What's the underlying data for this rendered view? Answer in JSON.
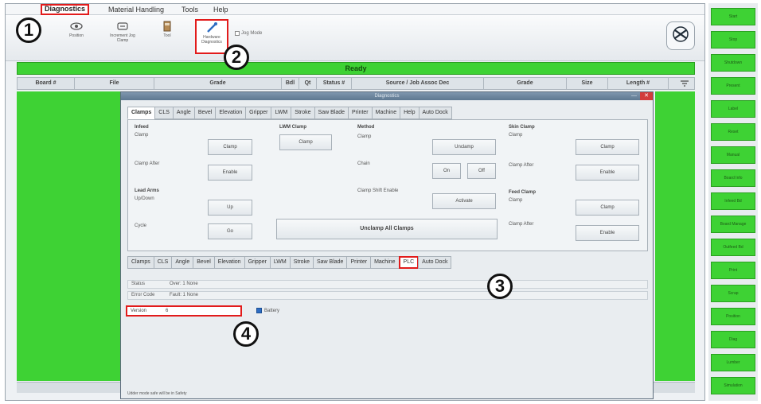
{
  "menubar": {
    "items": [
      "Diagnostics",
      "Material Handling",
      "Tools",
      "Help"
    ]
  },
  "toolbar": {
    "buttons": [
      "Position",
      "Increment Jog Clamp",
      "Tool",
      "Hardware Diagnostics"
    ],
    "checkbox_label": "Jog Mode"
  },
  "status": {
    "text": "Ready"
  },
  "columns": [
    "Board #",
    "File",
    "Grade",
    "Bdl",
    "Qt",
    "Status #",
    "Source / Job Assoc Dec",
    "Grade",
    "Size",
    "Length #"
  ],
  "sidebar": {
    "buttons": [
      "Start",
      "Stop",
      "Shutdown",
      "Present",
      "Label",
      "Reset",
      "Manual",
      "Board Info",
      "Infeed Bd",
      "Board Manage",
      "Outfeed Bd",
      "Print",
      "Scrap",
      "Position",
      "Diag",
      "Lumber",
      "Simulation"
    ]
  },
  "dialog": {
    "title": "Diagnostics",
    "minimize": "—",
    "close": "✕",
    "top_tabs": [
      "Clamps",
      "CLS",
      "Angle",
      "Bevel",
      "Elevation",
      "Gripper",
      "LWM",
      "Stroke",
      "Saw Blade",
      "Printer",
      "Machine",
      "Help",
      "Auto Dock"
    ],
    "bottom_tabs": [
      "Clamps",
      "CLS",
      "Angle",
      "Bevel",
      "Elevation",
      "Gripper",
      "LWM",
      "Stroke",
      "Saw Blade",
      "Printer",
      "Machine",
      "PLC",
      "Auto Dock"
    ],
    "clamps": {
      "infeed": {
        "title": "Infeed",
        "clamp_label": "Clamp",
        "clamp_button": "Clamp",
        "clamp_after_label": "Clamp After",
        "clamp_after_button": "Enable"
      },
      "lwm": {
        "title": "LWM Clamp",
        "button": "Clamp"
      },
      "lead_arms": {
        "title": "Lead Arms",
        "up_down_label": "Up/Down",
        "up_button": "Up",
        "cycle_label": "Cycle",
        "go_button": "Go"
      },
      "method": {
        "title": "Method",
        "clamp_label": "Clamp",
        "clamp_button": "Unclamp",
        "chain_label": "Chain",
        "on_button": "On",
        "off_button": "Off",
        "clamp_shift_label": "Clamp Shift Enable",
        "activate_button": "Activate"
      },
      "unclamp_all": "Unclamp All Clamps",
      "skin_clamp": {
        "title": "Skin Clamp",
        "clamp_label": "Clamp",
        "clamp_button": "Clamp",
        "clamp_after_label": "Clamp After",
        "enable_button": "Enable"
      },
      "feed_clamp": {
        "title": "Feed Clamp",
        "clamp_label": "Clamp",
        "clamp_button": "Clamp",
        "clamp_after_label": "Clamp After",
        "enable_button": "Enable"
      }
    },
    "plc": {
      "status_label": "Status",
      "status_value": "Over: 1 None",
      "error_label": "Error Code",
      "error_value": "Fault: 1 None",
      "version_label": "Version",
      "version_value": "6",
      "battery_label": "Battery"
    },
    "footer": "Udder mode safe will be in Safety"
  },
  "callouts": [
    "1",
    "2",
    "3",
    "4"
  ]
}
